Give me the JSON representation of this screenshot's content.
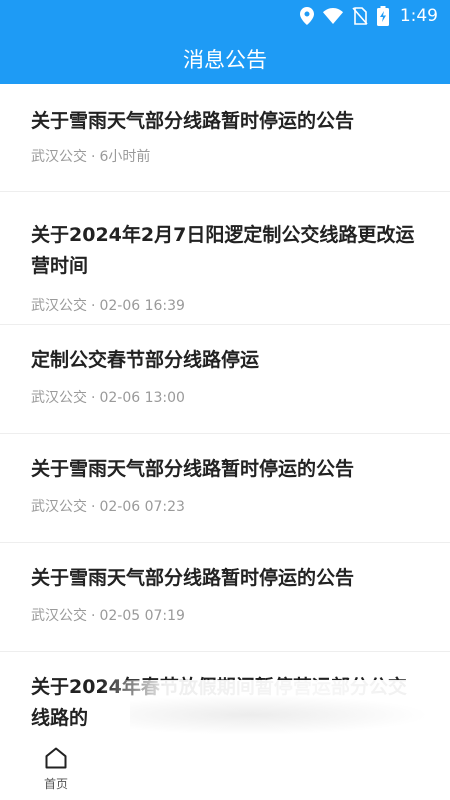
{
  "status_bar": {
    "time": "1:49",
    "icons": [
      "location-icon",
      "wifi-icon",
      "no-sim-icon",
      "battery-charging-icon"
    ]
  },
  "header": {
    "title": "消息公告",
    "color": "#1E9BF5"
  },
  "announcements": [
    {
      "title": "关于雪雨天气部分线路暂时停运的公告",
      "source": "武汉公交",
      "time": "6小时前"
    },
    {
      "title": "关于2024年2月7日阳逻定制公交线路更改运营时间",
      "source": "武汉公交",
      "time": "02-06 16:39"
    },
    {
      "title": "定制公交春节部分线路停运",
      "source": "武汉公交",
      "time": "02-06 13:00"
    },
    {
      "title": "关于雪雨天气部分线路暂时停运的公告",
      "source": "武汉公交",
      "time": "02-06 07:23"
    },
    {
      "title": "关于雪雨天气部分线路暂时停运的公告",
      "source": "武汉公交",
      "time": "02-05 07:19"
    },
    {
      "title": "关于2024年春节放假期间暂停营运部分公交线路的",
      "source": "",
      "time": ""
    }
  ],
  "bottom_nav": {
    "home_label": "首页",
    "home_icon": "home-icon"
  }
}
